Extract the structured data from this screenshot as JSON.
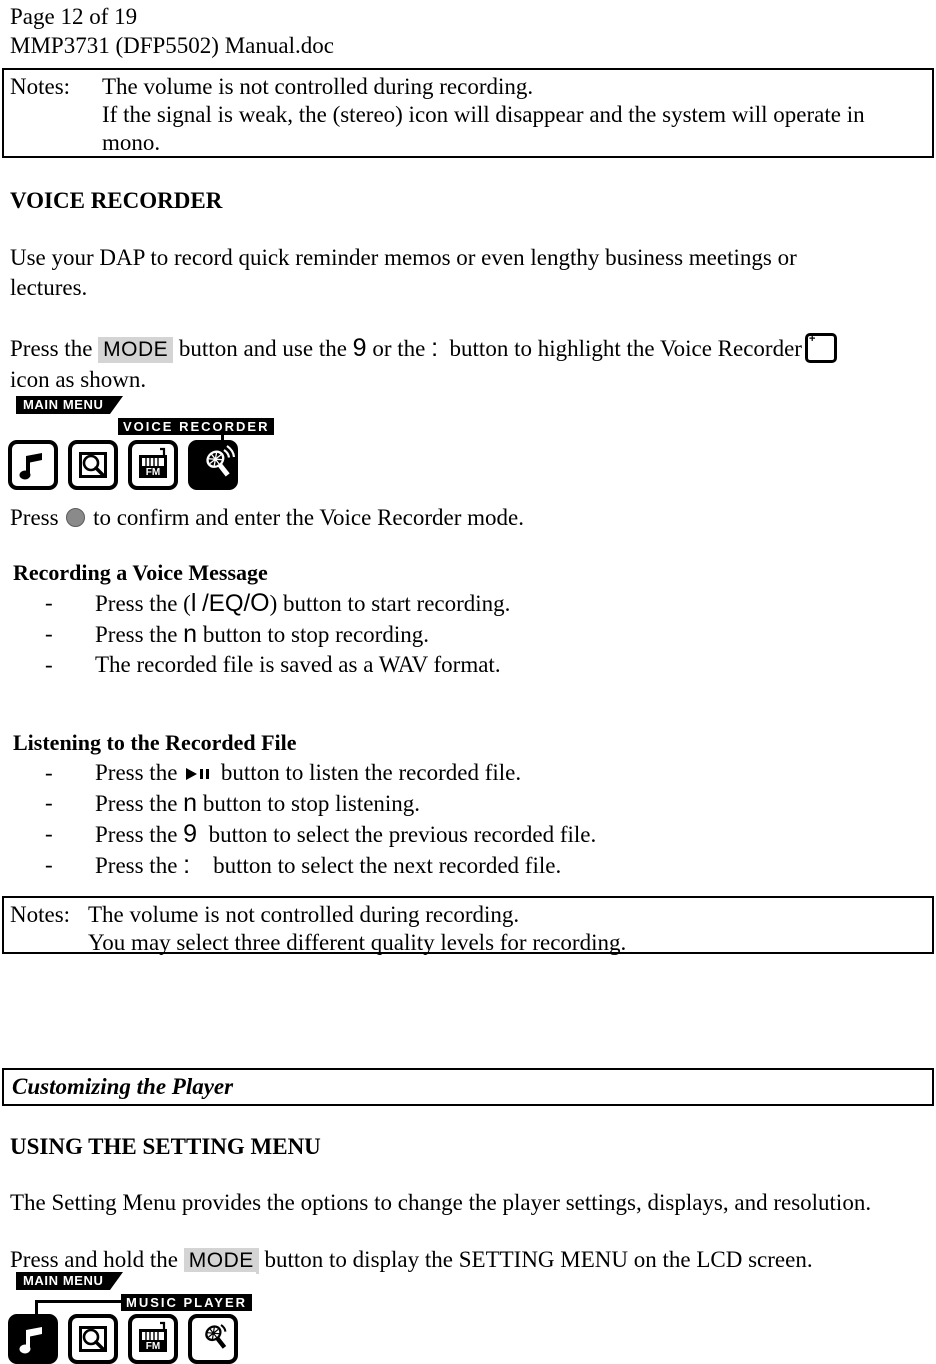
{
  "header": {
    "page_label": "Page 12 of 19",
    "file_name": "MMP3731 (DFP5502) Manual.doc"
  },
  "notes_top": {
    "label": "Notes:",
    "lines": [
      "The volume is not controlled during recording.",
      "If the signal is weak, the (stereo) icon will disappear and the system will operate in",
      "mono."
    ]
  },
  "voice_recorder": {
    "heading": "VOICE RECORDER",
    "intro_line1": "Use your DAP to record quick reminder memos or even lengthy business meetings or",
    "intro_line2": "lectures.",
    "press_mode": {
      "text_1": "Press the",
      "mode_key": "MODE",
      "text_2": "button and use the",
      "sym_prev": "9",
      "text_3": "or the",
      "sym_next": ":",
      "text_4": "button to highlight the Voice Recorder",
      "text_5": "icon as shown."
    },
    "confirm": {
      "text_1": "Press",
      "text_2": "to confirm and enter the Voice Recorder mode."
    }
  },
  "lcd_voice": {
    "menu_tab": "MAIN MENU",
    "selection_label": "VOICE RECORDER",
    "icons": [
      {
        "name": "music-note",
        "selected": false
      },
      {
        "name": "photo-browser",
        "selected": false
      },
      {
        "name": "fm-radio",
        "selected": false
      },
      {
        "name": "voice-recorder",
        "selected": true
      }
    ]
  },
  "recording_section": {
    "heading": "Recording a Voice Message",
    "items": [
      {
        "dash": "-",
        "pre": "Press the (",
        "sym": "l",
        "mid": "/EQ/",
        "sym2": "O",
        "post": ") button to start recording."
      },
      {
        "dash": "-",
        "pre": "Press the",
        "sym": "n",
        "post": "button to stop recording."
      },
      {
        "dash": "-",
        "pre": "The recorded file is saved as a WAV format.",
        "post": ""
      }
    ]
  },
  "listening_section": {
    "heading": "Listening to the Recorded File",
    "items": [
      {
        "dash": "-",
        "pre": "Press the",
        "glyph": "play-pause",
        "post": "button to listen the recorded file."
      },
      {
        "dash": "-",
        "pre": "Press the",
        "sym": "n",
        "post": "button to stop listening."
      },
      {
        "dash": "-",
        "pre": "Press the",
        "sym": "9",
        "post": "button to select the previous recorded file."
      },
      {
        "dash": "-",
        "pre": "Press the",
        "sym": ":",
        "post": "button to select the next recorded file."
      }
    ]
  },
  "notes_bottom": {
    "label": "Notes:",
    "lines": [
      "The volume is not controlled during recording.",
      "You may select three different quality levels for recording."
    ]
  },
  "customizing": {
    "section_title": "Customizing the Player",
    "heading": "USING THE SETTING MENU",
    "paragraph": "The Setting Menu provides the options to change the player settings, displays, and resolution.",
    "press_hold": {
      "text_1": "Press and hold the",
      "mode_key": "MODE",
      "text_2": "button to display the SETTING MENU on the LCD screen."
    }
  },
  "lcd_music": {
    "menu_tab": "MAIN MENU",
    "selection_label": "MUSIC PLAYER",
    "icons": [
      {
        "name": "music-note",
        "selected": true
      },
      {
        "name": "photo-browser",
        "selected": false
      },
      {
        "name": "fm-radio",
        "selected": false
      },
      {
        "name": "voice-recorder",
        "selected": false
      }
    ]
  },
  "colors": {
    "text": "#000000",
    "page_background": "#ffffff",
    "key_highlight": "#d4d4d4",
    "confirm_button": "#8a8a8a"
  }
}
